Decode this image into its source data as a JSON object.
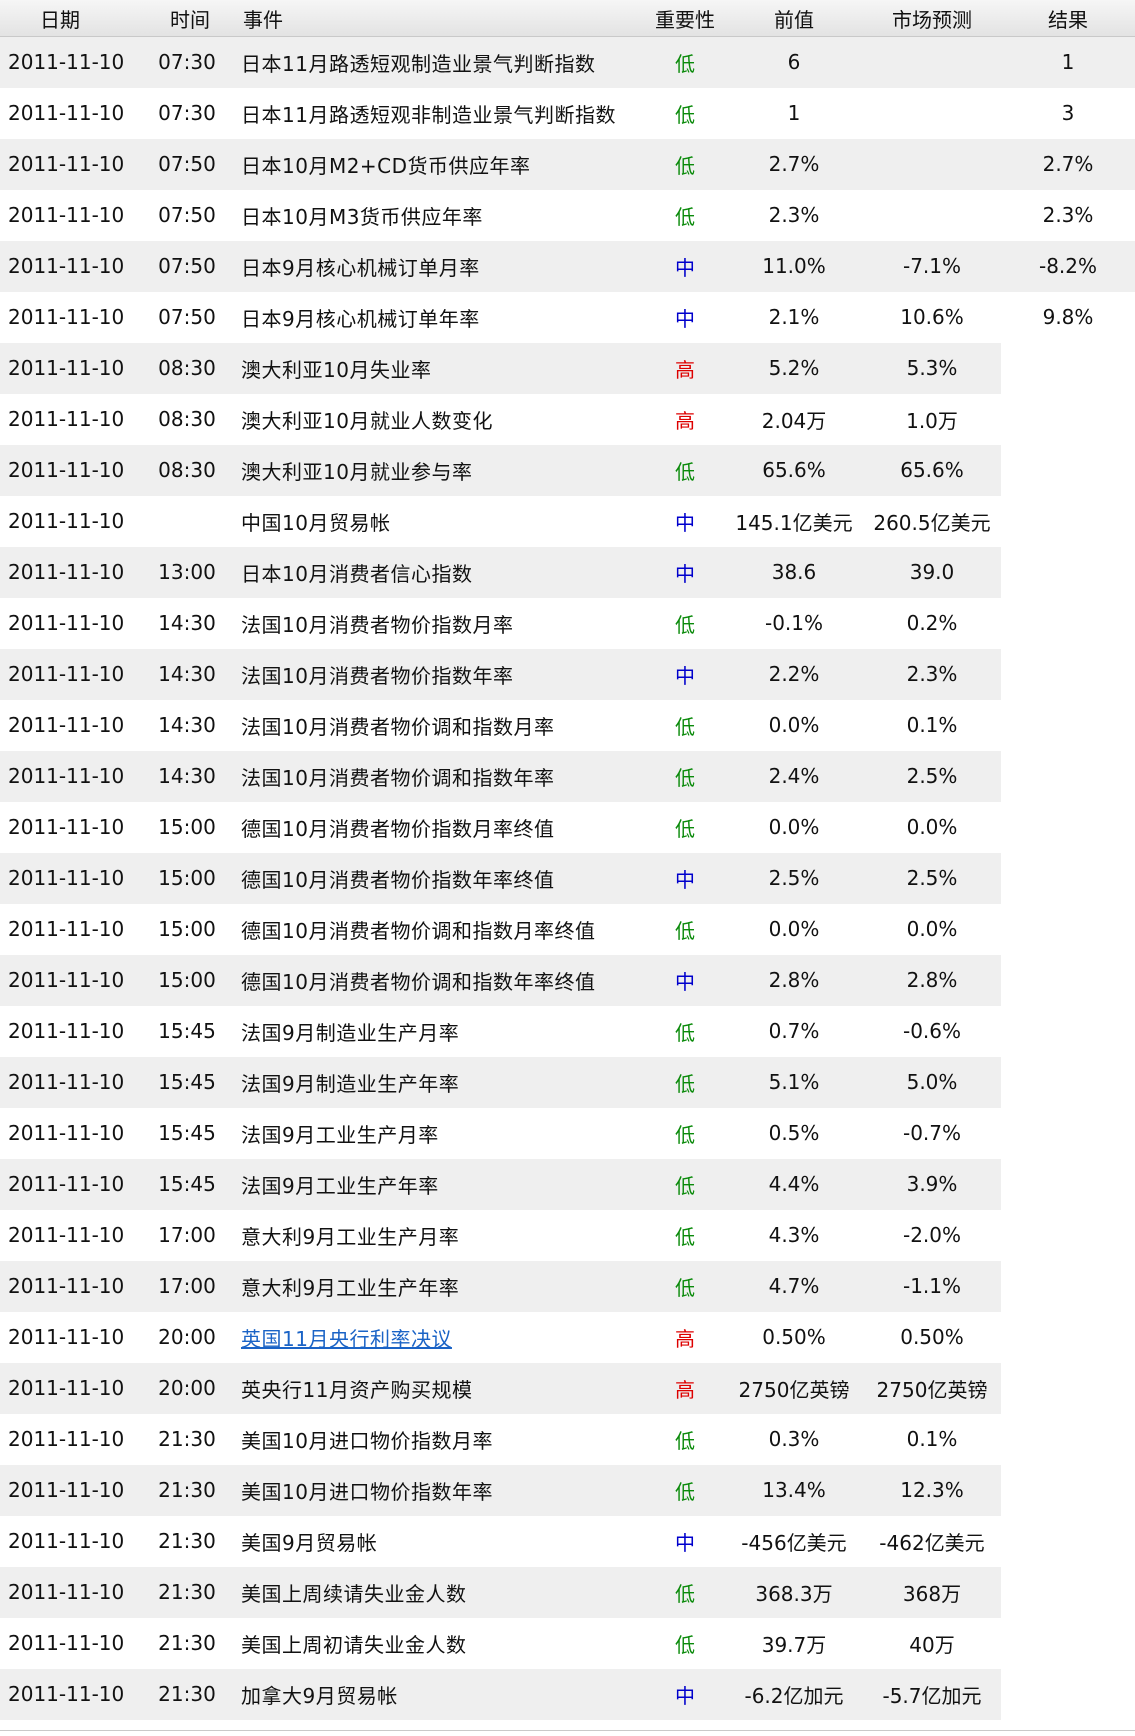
{
  "headers": {
    "date": "日期",
    "time": "时间",
    "event": "事件",
    "importance": "重要性",
    "previous": "前值",
    "forecast": "市场预测",
    "result": "结果"
  },
  "colors": {
    "low": "#0a8a0a",
    "medium": "#0000cc",
    "high": "#dd0000",
    "link": "#1a63c6",
    "row_shade": "#efefef"
  },
  "rows": [
    {
      "date": "2011-11-10",
      "time": "07:30",
      "event": "日本11月路透短观制造业景气判断指数",
      "importance": "低",
      "previous": "6",
      "forecast": "",
      "result": "1"
    },
    {
      "date": "2011-11-10",
      "time": "07:30",
      "event": "日本11月路透短观非制造业景气判断指数",
      "importance": "低",
      "previous": "1",
      "forecast": "",
      "result": "3"
    },
    {
      "date": "2011-11-10",
      "time": "07:50",
      "event": "日本10月M2+CD货币供应年率",
      "importance": "低",
      "previous": "2.7%",
      "forecast": "",
      "result": "2.7%"
    },
    {
      "date": "2011-11-10",
      "time": "07:50",
      "event": "日本10月M3货币供应年率",
      "importance": "低",
      "previous": "2.3%",
      "forecast": "",
      "result": "2.3%"
    },
    {
      "date": "2011-11-10",
      "time": "07:50",
      "event": "日本9月核心机械订单月率",
      "importance": "中",
      "previous": "11.0%",
      "forecast": "-7.1%",
      "result": "-8.2%"
    },
    {
      "date": "2011-11-10",
      "time": "07:50",
      "event": "日本9月核心机械订单年率",
      "importance": "中",
      "previous": "2.1%",
      "forecast": "10.6%",
      "result": "9.8%"
    },
    {
      "date": "2011-11-10",
      "time": "08:30",
      "event": "澳大利亚10月失业率",
      "importance": "高",
      "previous": "5.2%",
      "forecast": "5.3%",
      "result": ""
    },
    {
      "date": "2011-11-10",
      "time": "08:30",
      "event": "澳大利亚10月就业人数变化",
      "importance": "高",
      "previous": "2.04万",
      "forecast": "1.0万",
      "result": ""
    },
    {
      "date": "2011-11-10",
      "time": "08:30",
      "event": "澳大利亚10月就业参与率",
      "importance": "低",
      "previous": "65.6%",
      "forecast": "65.6%",
      "result": ""
    },
    {
      "date": "2011-11-10",
      "time": "",
      "event": "中国10月贸易帐",
      "importance": "中",
      "previous": "145.1亿美元",
      "forecast": "260.5亿美元",
      "result": ""
    },
    {
      "date": "2011-11-10",
      "time": "13:00",
      "event": "日本10月消费者信心指数",
      "importance": "中",
      "previous": "38.6",
      "forecast": "39.0",
      "result": ""
    },
    {
      "date": "2011-11-10",
      "time": "14:30",
      "event": "法国10月消费者物价指数月率",
      "importance": "低",
      "previous": "-0.1%",
      "forecast": "0.2%",
      "result": ""
    },
    {
      "date": "2011-11-10",
      "time": "14:30",
      "event": "法国10月消费者物价指数年率",
      "importance": "中",
      "previous": "2.2%",
      "forecast": "2.3%",
      "result": ""
    },
    {
      "date": "2011-11-10",
      "time": "14:30",
      "event": "法国10月消费者物价调和指数月率",
      "importance": "低",
      "previous": "0.0%",
      "forecast": "0.1%",
      "result": ""
    },
    {
      "date": "2011-11-10",
      "time": "14:30",
      "event": "法国10月消费者物价调和指数年率",
      "importance": "低",
      "previous": "2.4%",
      "forecast": "2.5%",
      "result": ""
    },
    {
      "date": "2011-11-10",
      "time": "15:00",
      "event": "德国10月消费者物价指数月率终值",
      "importance": "低",
      "previous": "0.0%",
      "forecast": "0.0%",
      "result": ""
    },
    {
      "date": "2011-11-10",
      "time": "15:00",
      "event": "德国10月消费者物价指数年率终值",
      "importance": "中",
      "previous": "2.5%",
      "forecast": "2.5%",
      "result": ""
    },
    {
      "date": "2011-11-10",
      "time": "15:00",
      "event": "德国10月消费者物价调和指数月率终值",
      "importance": "低",
      "previous": "0.0%",
      "forecast": "0.0%",
      "result": ""
    },
    {
      "date": "2011-11-10",
      "time": "15:00",
      "event": "德国10月消费者物价调和指数年率终值",
      "importance": "中",
      "previous": "2.8%",
      "forecast": "2.8%",
      "result": ""
    },
    {
      "date": "2011-11-10",
      "time": "15:45",
      "event": "法国9月制造业生产月率",
      "importance": "低",
      "previous": "0.7%",
      "forecast": "-0.6%",
      "result": ""
    },
    {
      "date": "2011-11-10",
      "time": "15:45",
      "event": "法国9月制造业生产年率",
      "importance": "低",
      "previous": "5.1%",
      "forecast": "5.0%",
      "result": ""
    },
    {
      "date": "2011-11-10",
      "time": "15:45",
      "event": "法国9月工业生产月率",
      "importance": "低",
      "previous": "0.5%",
      "forecast": "-0.7%",
      "result": ""
    },
    {
      "date": "2011-11-10",
      "time": "15:45",
      "event": "法国9月工业生产年率",
      "importance": "低",
      "previous": "4.4%",
      "forecast": "3.9%",
      "result": ""
    },
    {
      "date": "2011-11-10",
      "time": "17:00",
      "event": "意大利9月工业生产月率",
      "importance": "低",
      "previous": "4.3%",
      "forecast": "-2.0%",
      "result": ""
    },
    {
      "date": "2011-11-10",
      "time": "17:00",
      "event": "意大利9月工业生产年率",
      "importance": "低",
      "previous": "4.7%",
      "forecast": "-1.1%",
      "result": ""
    },
    {
      "date": "2011-11-10",
      "time": "20:00",
      "event": "英国11月央行利率决议",
      "importance": "高",
      "previous": "0.50%",
      "forecast": "0.50%",
      "result": "",
      "link": true
    },
    {
      "date": "2011-11-10",
      "time": "20:00",
      "event": "英央行11月资产购买规模",
      "importance": "高",
      "previous": "2750亿英镑",
      "forecast": "2750亿英镑",
      "result": ""
    },
    {
      "date": "2011-11-10",
      "time": "21:30",
      "event": "美国10月进口物价指数月率",
      "importance": "低",
      "previous": "0.3%",
      "forecast": "0.1%",
      "result": ""
    },
    {
      "date": "2011-11-10",
      "time": "21:30",
      "event": "美国10月进口物价指数年率",
      "importance": "低",
      "previous": "13.4%",
      "forecast": "12.3%",
      "result": ""
    },
    {
      "date": "2011-11-10",
      "time": "21:30",
      "event": "美国9月贸易帐",
      "importance": "中",
      "previous": "-456亿美元",
      "forecast": "-462亿美元",
      "result": ""
    },
    {
      "date": "2011-11-10",
      "time": "21:30",
      "event": "美国上周续请失业金人数",
      "importance": "低",
      "previous": "368.3万",
      "forecast": "368万",
      "result": ""
    },
    {
      "date": "2011-11-10",
      "time": "21:30",
      "event": "美国上周初请失业金人数",
      "importance": "低",
      "previous": "39.7万",
      "forecast": "40万",
      "result": ""
    },
    {
      "date": "2011-11-10",
      "time": "21:30",
      "event": "加拿大9月贸易帐",
      "importance": "中",
      "previous": "-6.2亿加元",
      "forecast": "-5.7亿加元",
      "result": ""
    }
  ]
}
